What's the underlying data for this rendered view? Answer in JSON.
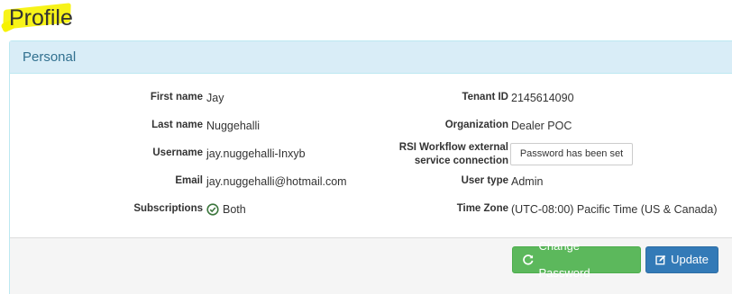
{
  "page": {
    "title": "Profile"
  },
  "panel": {
    "heading": "Personal"
  },
  "left_fields": [
    {
      "label": "First name",
      "value": "Jay"
    },
    {
      "label": "Last name",
      "value": "Nuggehalli"
    },
    {
      "label": "Username",
      "value": "jay.nuggehalli-Inxyb"
    },
    {
      "label": "Email",
      "value": "jay.nuggehalli@hotmail.com"
    },
    {
      "label": "Subscriptions",
      "value": "Both"
    }
  ],
  "right_fields": [
    {
      "label": "Tenant ID",
      "value": "2145614090"
    },
    {
      "label": "Organization",
      "value": "Dealer POC"
    },
    {
      "label_line1": "RSI Workflow external",
      "label_line2": "service connection",
      "value": "Password has been set"
    },
    {
      "label": "User type",
      "value": "Admin"
    },
    {
      "label": "Time Zone",
      "value": "(UTC-08:00) Pacific Time (US & Canada)"
    }
  ],
  "actions": {
    "change_password": "Change Password",
    "update": "Update"
  },
  "colors": {
    "highlight": "#f6f200",
    "panel_heading_bg": "#d9edf7",
    "panel_heading_text": "#31708f",
    "success": "#5cb85c",
    "primary": "#337ab7",
    "check_icon": "#3c763d"
  }
}
